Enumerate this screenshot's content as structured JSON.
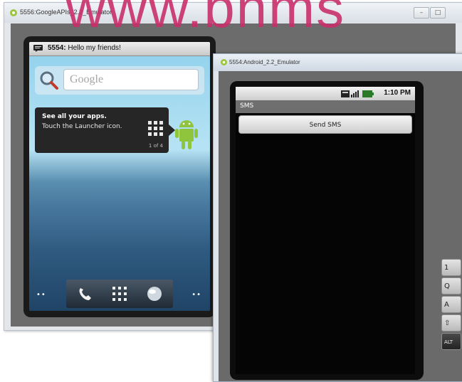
{
  "watermark": "www.bhms",
  "window_back": {
    "title": "5556:GoogleAPIs_2.2_Emulator",
    "notification": {
      "sender": "5554:",
      "message": "Hello my friends!"
    },
    "search_placeholder": "Google",
    "tip": {
      "title": "See all your apps.",
      "line": "Touch the Launcher icon.",
      "pager": "1 of 4"
    },
    "dock": {
      "dots_left": "••",
      "dots_right": "••"
    }
  },
  "window_front": {
    "title": "5554:Android_2.2_Emulator",
    "status_time": "1:10 PM",
    "app_title": "SMS",
    "send_button": "Send SMS",
    "keys": [
      "1",
      "Q",
      "A",
      "⇧",
      "ALT"
    ]
  },
  "colors": {
    "watermark": "#c9306b",
    "emulator_frame": "#6c6c6c"
  },
  "icons": [
    "android-emulator-icon",
    "sms-notification-icon",
    "search-magnifier-icon",
    "launcher-grid-icon",
    "android-robot-icon",
    "phone-icon",
    "apps-grid-icon",
    "browser-globe-icon",
    "signal-icon",
    "battery-icon"
  ]
}
